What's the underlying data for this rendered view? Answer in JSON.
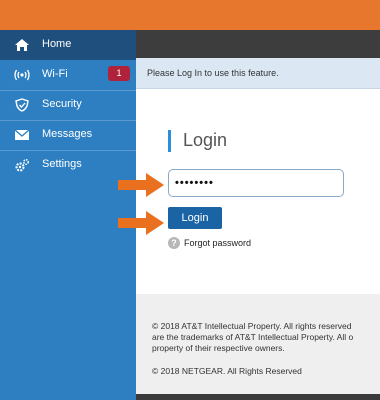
{
  "sidebar": {
    "items": [
      {
        "label": "Home",
        "icon": "home-icon",
        "active": true
      },
      {
        "label": "Wi-Fi",
        "icon": "wifi-icon",
        "badge": "1"
      },
      {
        "label": "Security",
        "icon": "shield-icon"
      },
      {
        "label": "Messages",
        "icon": "envelope-icon"
      },
      {
        "label": "Settings",
        "icon": "gear-icon"
      }
    ]
  },
  "notice": "Please Log In to use this feature.",
  "login": {
    "title": "Login",
    "password_value": "••••••••",
    "button_label": "Login",
    "help_glyph": "?",
    "forgot_label": "Forgot password"
  },
  "footer": {
    "line1": "© 2018 AT&T Intellectual Property. All rights reserved",
    "line2": "are the trademarks of AT&T Intellectual Property. All o",
    "line3": "property of their respective owners.",
    "line4": "© 2018 NETGEAR. All Rights Reserved"
  },
  "colors": {
    "topbar": "#e8772e",
    "sidebar": "#2e7fc1",
    "sidebar_active": "#1e4f7d",
    "button": "#1a64a6",
    "badge": "#b0223a",
    "arrow": "#e8701e"
  }
}
